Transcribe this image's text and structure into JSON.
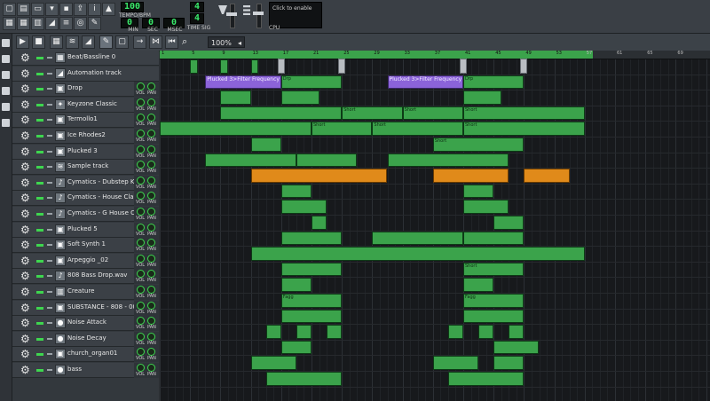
{
  "header": {
    "tempo_label": "TEMPO/BPM",
    "tempo_value": "100",
    "min_label": "MIN",
    "min_value": "0",
    "sec_label": "SEC",
    "sec_value": "0",
    "msec_label": "MSEC",
    "msec_value": "0",
    "timesig_label": "TIME SIG",
    "timesig_num": "4",
    "timesig_den": "4",
    "cpu_label": "CPU",
    "cpu_hint": "Click to enable"
  },
  "editor": {
    "zoom_value": "100%",
    "zoom_arrow": "◂"
  },
  "timeline": {
    "bars": [
      "1",
      "5",
      "9",
      "13",
      "17",
      "21",
      "25",
      "29",
      "33",
      "37",
      "41",
      "45",
      "49",
      "53",
      "57",
      "61",
      "65",
      "69"
    ]
  },
  "tracks": [
    {
      "name": "Beat/Bassline 0",
      "icon": "beat-icon",
      "glyph": "▦"
    },
    {
      "name": "Automation track",
      "icon": "automation-icon",
      "glyph": "◢"
    },
    {
      "name": "Drop",
      "icon": "instrument-icon",
      "glyph": "▣"
    },
    {
      "name": "Keyzone Classic",
      "icon": "keyzone-icon",
      "glyph": "✦"
    },
    {
      "name": "Termollo1",
      "icon": "instrument-icon",
      "glyph": "▣"
    },
    {
      "name": "Ice Rhodes2",
      "icon": "instrument-icon",
      "glyph": "▣"
    },
    {
      "name": "Plucked 3",
      "icon": "instrument-icon",
      "glyph": "▣"
    },
    {
      "name": "Sample track",
      "icon": "sample-wave-icon",
      "glyph": "≋"
    },
    {
      "name": "Cymatics - Dubstep Kic...",
      "icon": "note-icon",
      "glyph": "♪"
    },
    {
      "name": "Cymatics - House Clap ...",
      "icon": "note-icon",
      "glyph": "♪"
    },
    {
      "name": "Cymatics - G House Cl...",
      "icon": "note-icon",
      "glyph": "♪"
    },
    {
      "name": "Plucked 5",
      "icon": "instrument-icon",
      "glyph": "▣"
    },
    {
      "name": "Soft Synth 1",
      "icon": "instrument-icon",
      "glyph": "▣"
    },
    {
      "name": "Arpeggio _02",
      "icon": "instrument-icon",
      "glyph": "▣"
    },
    {
      "name": "808 Bass Drop.wav",
      "icon": "note-icon",
      "glyph": "♪"
    },
    {
      "name": "Creature",
      "icon": "piano-icon",
      "glyph": "▥"
    },
    {
      "name": "SUBSTANCE - 808 - 009",
      "icon": "instrument-icon",
      "glyph": "▣"
    },
    {
      "name": "Noise Attack",
      "icon": "noise-icon",
      "glyph": "●"
    },
    {
      "name": "Noise Decay",
      "icon": "noise-icon",
      "glyph": "●"
    },
    {
      "name": "church_organ01",
      "icon": "instrument-icon",
      "glyph": "▣"
    },
    {
      "name": "bass",
      "icon": "noise-icon",
      "glyph": "●"
    }
  ],
  "knob_labels": {
    "vol": "VOL",
    "pan": "PAN"
  },
  "clip_labels": {
    "automation": "Plucked 3>Filter Frequency",
    "drop": "Drp",
    "short": "Short",
    "fagg": "Fagg"
  },
  "colors": {
    "pattern_green": "#2fb04b",
    "automation_purple": "#8b63d9",
    "sample_orange": "#e08a1a",
    "lcd_green": "#39e86a"
  }
}
